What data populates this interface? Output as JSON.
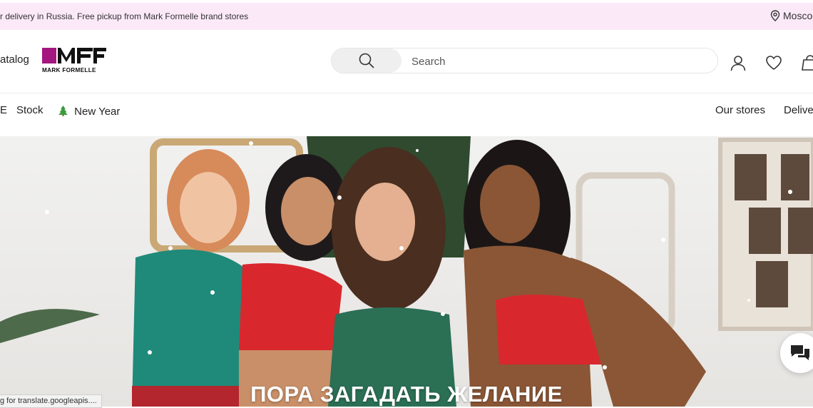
{
  "topbar": {
    "promo": "r delivery in Russia. Free pickup from Mark Formelle brand stores",
    "city": "Mosco"
  },
  "header": {
    "catalog_label": "atalog",
    "logo": {
      "brand_name": "MARK FORMELLE",
      "monogram": "MF",
      "accent_color": "#a3177f"
    },
    "search": {
      "placeholder": "Search",
      "value": ""
    },
    "icons": [
      "user-icon",
      "heart-icon",
      "cart-icon"
    ]
  },
  "nav": {
    "left_edge_fragment": "E",
    "items": [
      {
        "label": "Stock"
      },
      {
        "label": "New Year",
        "icon": "christmas-tree-icon"
      }
    ],
    "right_items": [
      {
        "label": "Our stores"
      },
      {
        "label": "Delive"
      }
    ]
  },
  "hero": {
    "headline": "ПОРА ЗАГАДАТЬ ЖЕЛАНИЕ"
  },
  "chat": {
    "icon": "chat-bubbles-icon"
  },
  "status_bar": {
    "text": "g for translate.googleapis...."
  },
  "colors": {
    "topbar_bg": "#fbe9f8",
    "brand_accent": "#a3177f",
    "text": "#222222"
  }
}
